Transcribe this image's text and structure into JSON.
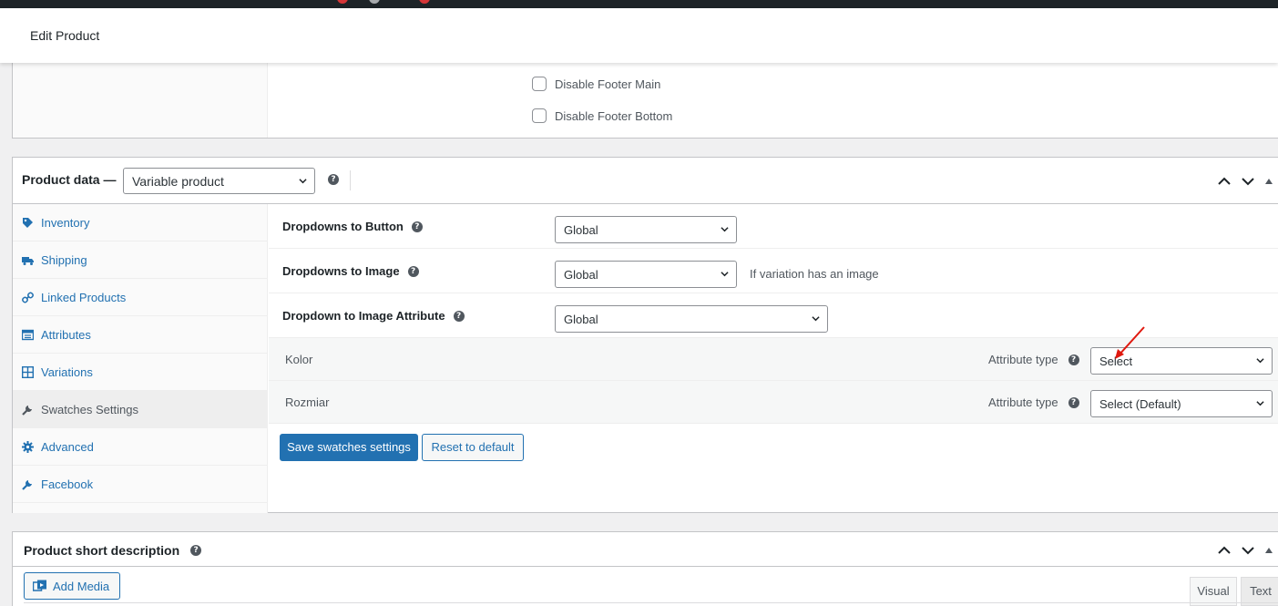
{
  "page": {
    "title": "Edit Product"
  },
  "top_box": {
    "checkboxes": [
      {
        "label": "Disable Footer Main",
        "checked": false
      },
      {
        "label": "Disable Footer Bottom",
        "checked": false
      }
    ]
  },
  "product_data": {
    "title": "Product data —",
    "type_value": "Variable product",
    "tabs": [
      {
        "label": "Inventory",
        "icon": "tag-icon"
      },
      {
        "label": "Shipping",
        "icon": "truck-icon"
      },
      {
        "label": "Linked Products",
        "icon": "link-icon"
      },
      {
        "label": "Attributes",
        "icon": "list-icon"
      },
      {
        "label": "Variations",
        "icon": "grid-icon"
      },
      {
        "label": "Swatches Settings",
        "icon": "wrench-icon",
        "active": true
      },
      {
        "label": "Advanced",
        "icon": "gear-icon"
      },
      {
        "label": "Facebook",
        "icon": "wrench-icon"
      }
    ],
    "settings": {
      "dropdowns_to_button": {
        "label": "Dropdowns to Button",
        "value": "Global"
      },
      "dropdowns_to_image": {
        "label": "Dropdowns to Image",
        "value": "Global",
        "note": "If variation has an image"
      },
      "dropdown_to_image_attribute": {
        "label": "Dropdown to Image Attribute",
        "value": "Global"
      }
    },
    "attributes": [
      {
        "name": "Kolor",
        "type_label": "Attribute type",
        "value": "Select"
      },
      {
        "name": "Rozmiar",
        "type_label": "Attribute type",
        "value": "Select (Default)"
      }
    ],
    "save_label": "Save swatches settings",
    "reset_label": "Reset to default"
  },
  "short_description": {
    "title": "Product short description",
    "add_media_label": "Add Media",
    "tab_visual": "Visual",
    "tab_text": "Text"
  },
  "colors": {
    "accent": "#2271b1",
    "annotation_arrow": "#e0190f"
  }
}
